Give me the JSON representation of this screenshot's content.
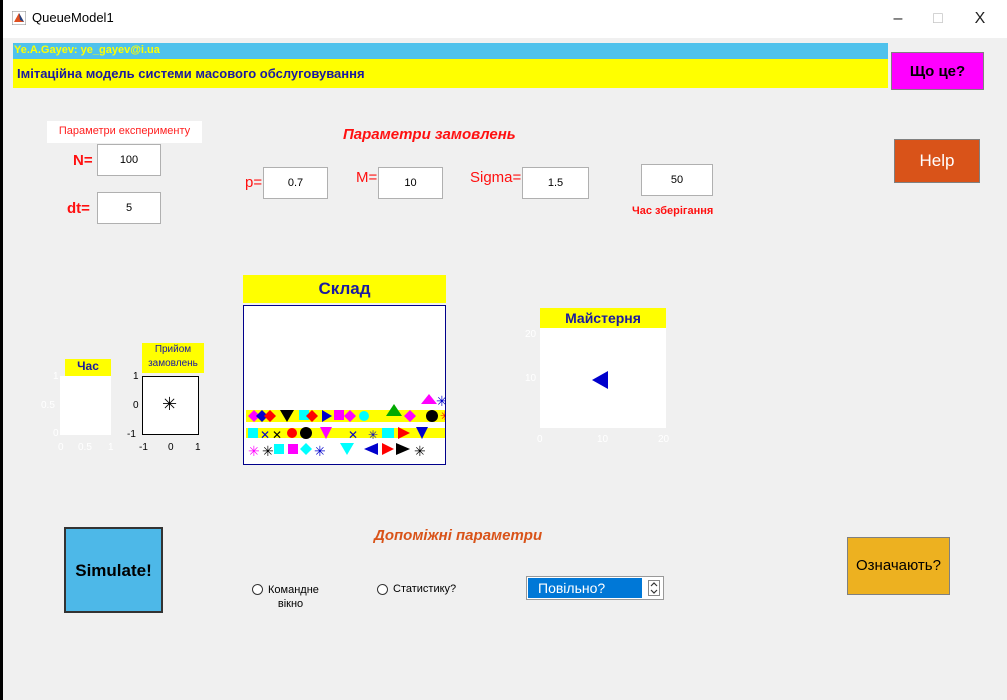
{
  "window": {
    "title": "QueueModel1",
    "minimize": "–",
    "maximize": "□",
    "close": "X"
  },
  "header": {
    "author": "Ye.A.Gayev: ye_gayev@i.ua",
    "subtitle": "Імітаційна модель системи масового обслуговування",
    "what_button": "Що це?"
  },
  "experiment": {
    "box_label": "Параметри експерименту",
    "n_label": "N=",
    "n_value": "100",
    "dt_label": "dt=",
    "dt_value": "5"
  },
  "orders": {
    "title": "Параметри замовлень",
    "p_label": "p=",
    "p_value": "0.7",
    "m_label": "M=",
    "m_value": "10",
    "sigma_label": "Sigma=",
    "sigma_value": "1.5",
    "storage_time_value": "50",
    "storage_time_label": "Час зберігання"
  },
  "help_button": "Help",
  "plots": {
    "time": {
      "title": "Час",
      "x_ticks": [
        "0",
        "0.5",
        "1"
      ],
      "y_ticks": [
        "1",
        "0.5",
        "0"
      ]
    },
    "orders_received": {
      "title": "Прийом замовлень",
      "x_ticks": [
        "-1",
        "0",
        "1"
      ],
      "y_ticks": [
        "1",
        "0",
        "-1"
      ],
      "marker": "✳"
    },
    "warehouse": {
      "title": "Склад"
    },
    "workshop": {
      "title": "Майстерня",
      "x_ticks": [
        "0",
        "10",
        "20"
      ],
      "y_ticks": [
        "20",
        "10"
      ]
    }
  },
  "simulate_button": "Simulate!",
  "auxiliary": {
    "title": "Допоміжні параметри",
    "command_window": "Командне вікно",
    "statistics": "Статистику?",
    "speed_select": "Повільно?",
    "mean_button": "Означають?"
  },
  "colors": {
    "cyan_bar": "#4fc2ec",
    "yellow": "#ffff00",
    "magenta": "#ff00ff",
    "help": "#d95319",
    "simulate": "#4db8e8",
    "orange": "#edb120"
  }
}
